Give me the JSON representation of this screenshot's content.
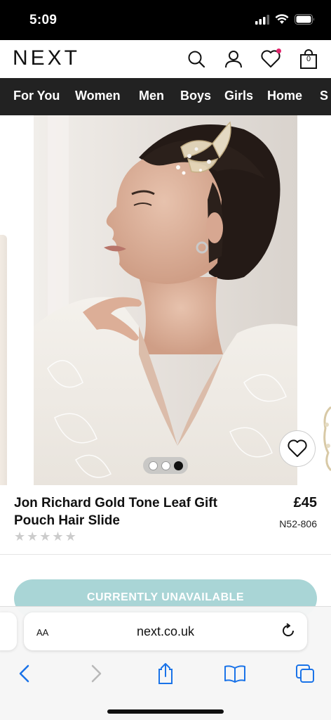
{
  "status_bar": {
    "time": "5:09"
  },
  "header": {
    "logo": "NEXT",
    "bag_count": "0",
    "icons": [
      "search-icon",
      "account-icon",
      "wishlist-icon",
      "bag-icon"
    ]
  },
  "nav": {
    "items": [
      {
        "label": "For You"
      },
      {
        "label": "Women"
      },
      {
        "label": "Men"
      },
      {
        "label": "Boys"
      },
      {
        "label": "Girls"
      },
      {
        "label": "Home"
      },
      {
        "label": "S"
      }
    ]
  },
  "product": {
    "title": "Jon Richard Gold Tone Leaf Gift Pouch Hair Slide",
    "price": "£45",
    "code": "N52-806",
    "rating_stars": 5,
    "rating_value": 0,
    "image_count": 3,
    "active_image": 3,
    "cta": "CURRENTLY UNAVAILABLE"
  },
  "browser": {
    "text_size_label": "AA",
    "url": "next.co.uk"
  },
  "colors": {
    "nav_bg": "#222222",
    "cta_bg": "#a9d5d6",
    "wishlist_dot": "#e0246b"
  }
}
